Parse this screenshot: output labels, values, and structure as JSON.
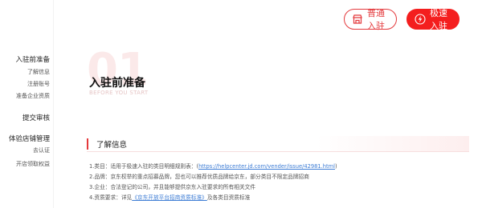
{
  "header": {
    "normal_join_label": "普通入驻",
    "fast_join_label": "极速入驻"
  },
  "sidebar": {
    "groups": [
      {
        "title": "入驻前准备",
        "items": [
          "了解信息",
          "注册账号",
          "准备企业资质"
        ]
      },
      {
        "title": "提交审核",
        "items": []
      },
      {
        "title": "体验店铺管理",
        "items": [
          "去认证",
          "开店领取权益"
        ]
      }
    ]
  },
  "main": {
    "step_number": "01",
    "section_title": "入驻前准备",
    "section_subtitle": "BEFORE YOU START",
    "panel_title": "了解信息",
    "lines": {
      "l1_prefix": "1.类目：适用于极速入驻的类目明细规则表：(",
      "l1_link": "https://helpcenter.jd.com/vender/issue/42981.html",
      "l1_suffix": ")",
      "l2": "2.品牌：京东权举的重点招募品牌，您也可以推荐优质品牌给京东，部分类目不限定品牌招商",
      "l3": "3.企业：合法登记的公司，并且能够提供京东入驻要求的所有相关文件",
      "l4_prefix": "4.资质要求：详见",
      "l4_link": "《京东开放平台招商资质标准》",
      "l4_suffix": "及各类目资质标准"
    }
  },
  "colors": {
    "accent": "#e4393c",
    "fast_button": "#f41e1e",
    "link": "#3b7bd4"
  }
}
